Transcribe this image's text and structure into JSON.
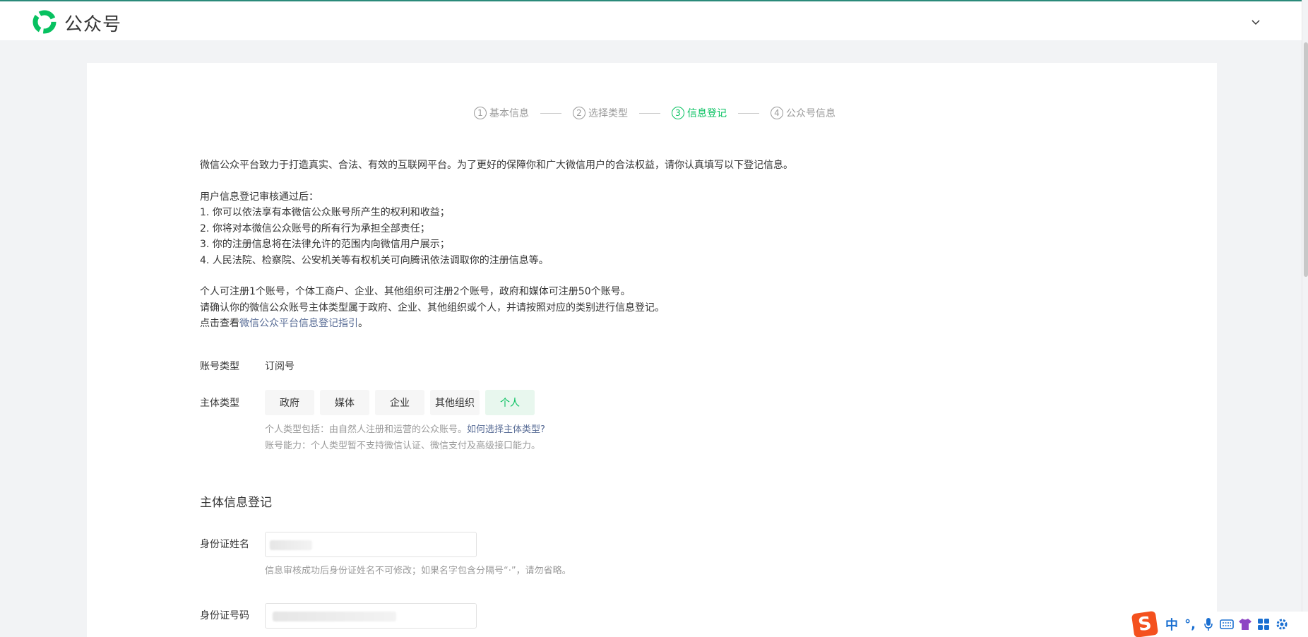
{
  "header": {
    "app_name": "公众号",
    "brand_color": "#07c160",
    "logo_icon": "wechat-official-account-logo-icon",
    "account_menu_icon": "chevron-down-icon"
  },
  "steps": [
    {
      "num": "1",
      "label": "基本信息",
      "active": false
    },
    {
      "num": "2",
      "label": "选择类型",
      "active": false
    },
    {
      "num": "3",
      "label": "信息登记",
      "active": true
    },
    {
      "num": "4",
      "label": "公众号信息",
      "active": false
    }
  ],
  "intro": {
    "p1": "微信公众平台致力于打造真实、合法、有效的互联网平台。为了更好的保障你和广大微信用户的合法权益，请你认真填写以下登记信息。",
    "list_title": "用户信息登记审核通过后：",
    "item1": "1. 你可以依法享有本微信公众账号所产生的权利和收益；",
    "item2": "2. 你将对本微信公众账号的所有行为承担全部责任；",
    "item3": "3. 你的注册信息将在法律允许的范围内向微信用户展示；",
    "item4": "4. 人民法院、检察院、公安机关等有权机关可向腾讯依法调取你的注册信息等。",
    "p3": "个人可注册1个账号，个体工商户、企业、其他组织可注册2个账号，政府和媒体可注册50个账号。",
    "p4": "请确认你的微信公众账号主体类型属于政府、企业、其他组织或个人，并请按照对应的类别进行信息登记。",
    "p5_prefix": "点击查看",
    "p5_link": "微信公众平台信息登记指引",
    "p5_suffix": "。"
  },
  "account_type": {
    "label": "账号类型",
    "value": "订阅号"
  },
  "subject_type": {
    "label": "主体类型",
    "options": [
      "政府",
      "媒体",
      "企业",
      "其他组织",
      "个人"
    ],
    "selected": "个人",
    "hint1_prefix": "个人类型包括：由自然人注册和运营的公众账号。",
    "hint1_link": "如何选择主体类型?",
    "hint2": "账号能力：个人类型暂不支持微信认证、微信支付及高级接口能力。"
  },
  "subject_info": {
    "title": "主体信息登记",
    "id_name_label": "身份证姓名",
    "id_name_hint": "信息审核成功后身份证姓名不可修改；如果名字包含分隔号“·”，请勿省略。",
    "id_number_label": "身份证号码"
  },
  "ime_toolbar": {
    "logo": "S",
    "mode": "中",
    "punct": "°,",
    "icons": [
      "microphone-icon",
      "keyboard-icon",
      "skin-icon",
      "toolbox-icon",
      "settings-icon"
    ]
  }
}
